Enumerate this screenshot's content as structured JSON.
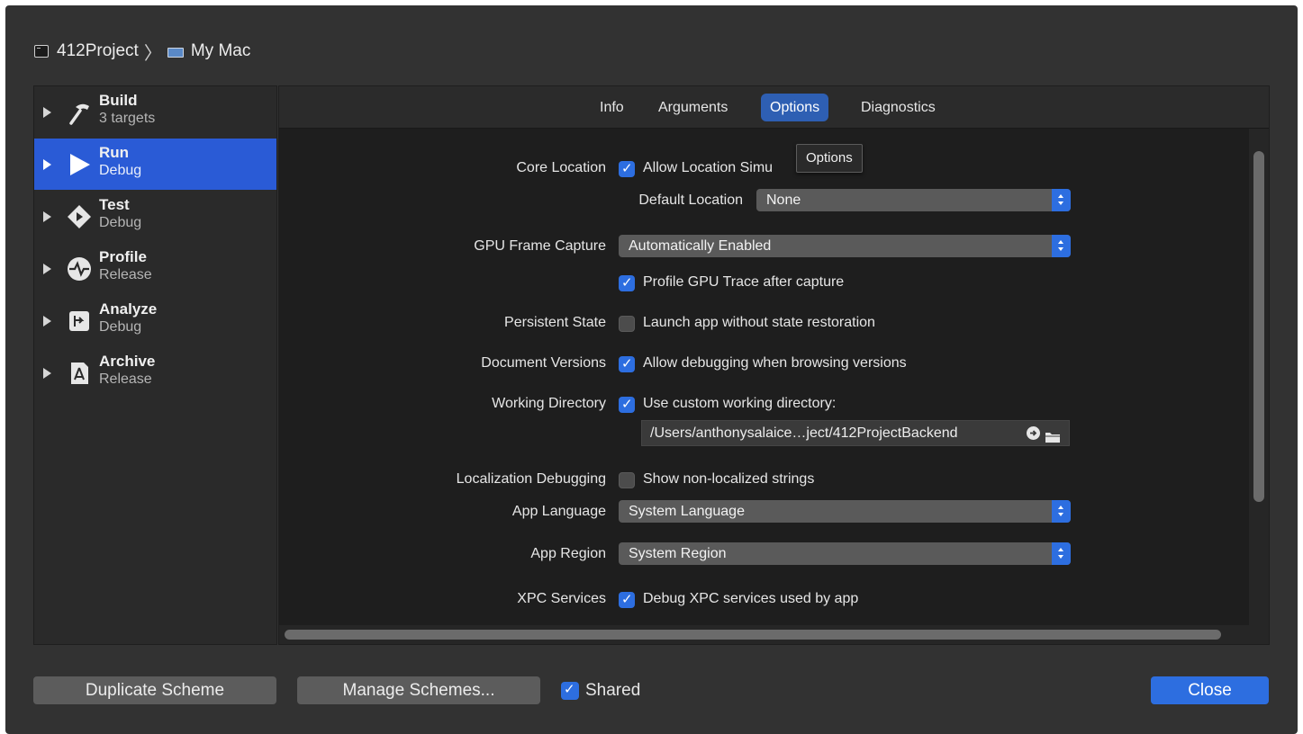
{
  "breadcrumb": {
    "project": "412Project",
    "destination": "My Mac"
  },
  "sidebar": {
    "items": [
      {
        "action": "Build",
        "detail": "3 targets",
        "icon": "hammer-icon"
      },
      {
        "action": "Run",
        "detail": "Debug",
        "icon": "play-icon",
        "selected": true
      },
      {
        "action": "Test",
        "detail": "Debug",
        "icon": "test-diamond-icon"
      },
      {
        "action": "Profile",
        "detail": "Release",
        "icon": "instruments-gauge-icon"
      },
      {
        "action": "Analyze",
        "detail": "Debug",
        "icon": "analyze-icon"
      },
      {
        "action": "Archive",
        "detail": "Release",
        "icon": "archive-icon"
      }
    ]
  },
  "tabs": [
    {
      "label": "Info"
    },
    {
      "label": "Arguments"
    },
    {
      "label": "Options",
      "active": true
    },
    {
      "label": "Diagnostics"
    }
  ],
  "tooltip": "Options",
  "options": {
    "core_location": {
      "label": "Core Location",
      "checkbox": "Allow Location Simu",
      "checked": true
    },
    "default_location": {
      "label": "Default Location",
      "value": "None"
    },
    "gpu_frame_capture": {
      "label": "GPU Frame Capture",
      "value": "Automatically Enabled"
    },
    "profile_gpu": {
      "checkbox": "Profile GPU Trace after capture",
      "checked": true
    },
    "persistent_state": {
      "label": "Persistent State",
      "checkbox": "Launch app without state restoration",
      "checked": false
    },
    "document_versions": {
      "label": "Document Versions",
      "checkbox": "Allow debugging when browsing versions",
      "checked": true
    },
    "working_directory": {
      "label": "Working Directory",
      "checkbox": "Use custom working directory:",
      "checked": true,
      "path": "/Users/anthonysalaice…ject/412ProjectBackend"
    },
    "localization_debugging": {
      "label": "Localization Debugging",
      "checkbox": "Show non-localized strings",
      "checked": false
    },
    "app_language": {
      "label": "App Language",
      "value": "System Language"
    },
    "app_region": {
      "label": "App Region",
      "value": "System Region"
    },
    "xpc_services": {
      "label": "XPC Services",
      "checkbox": "Debug XPC services used by app",
      "checked": true
    }
  },
  "footer": {
    "duplicate_label": "Duplicate Scheme",
    "manage_label": "Manage Schemes...",
    "shared_label": "Shared",
    "shared_checked": true,
    "close_label": "Close"
  },
  "colors": {
    "accent": "#2d6ee0",
    "selection": "#2a5bd6",
    "background": "#323232"
  }
}
